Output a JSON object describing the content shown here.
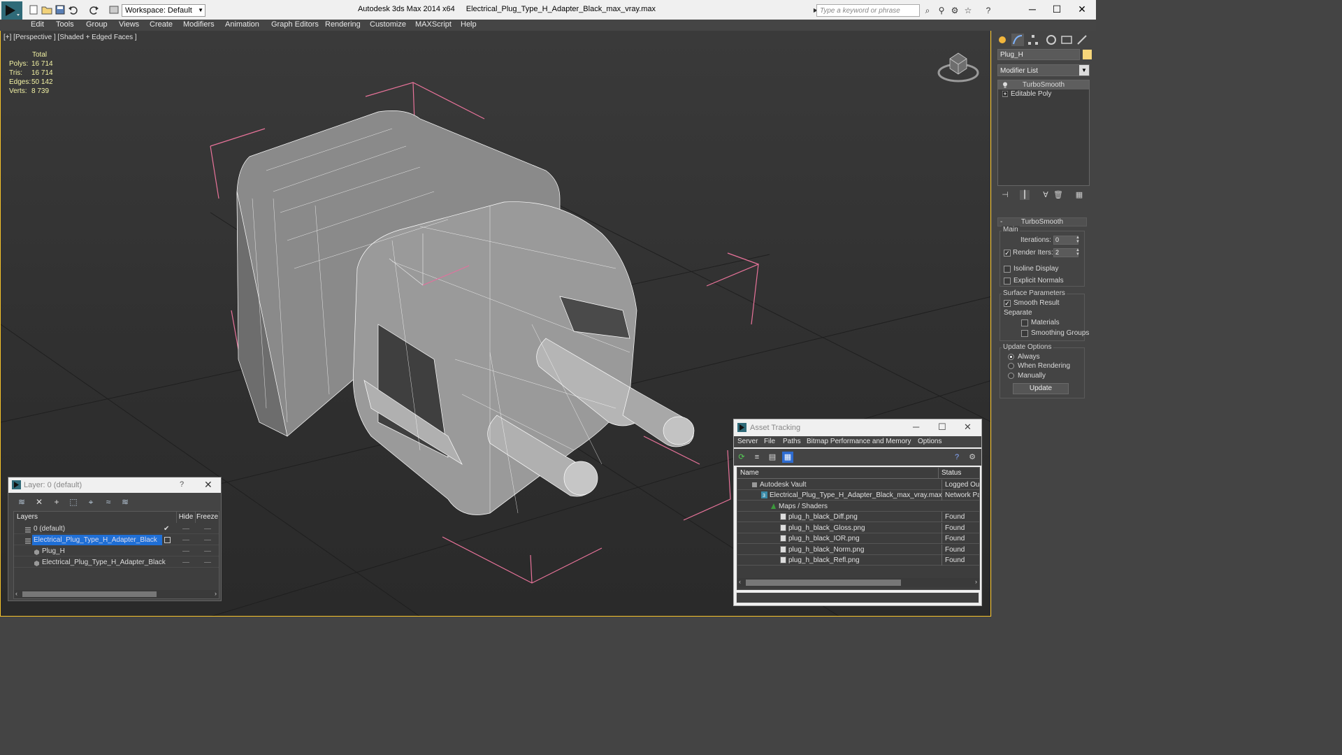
{
  "titlebar": {
    "workspace": "Workspace: Default",
    "app_name": "Autodesk 3ds Max  2014 x64",
    "file_name": "Electrical_Plug_Type_H_Adapter_Black_max_vray.max",
    "search_placeholder": "Type a keyword or phrase"
  },
  "menu": [
    "Edit",
    "Tools",
    "Group",
    "Views",
    "Create",
    "Modifiers",
    "Animation",
    "Graph Editors",
    "Rendering",
    "Customize",
    "MAXScript",
    "Help"
  ],
  "viewport": {
    "label": "[+] [Perspective ] [Shaded + Edged Faces ]",
    "stats": {
      "header": "Total",
      "rows": [
        {
          "label": "Polys:",
          "value": "16 714"
        },
        {
          "label": "Tris:",
          "value": "16 714"
        },
        {
          "label": "Edges:",
          "value": "50 142"
        },
        {
          "label": "Verts:",
          "value": "8 739"
        }
      ]
    }
  },
  "command_panel": {
    "object_name": "Plug_H",
    "object_color": "#f7d67a",
    "modifier_list": "Modifier List",
    "stack": [
      "TurboSmooth",
      "Editable Poly"
    ],
    "rollout_title": "TurboSmooth",
    "main_group": "Main",
    "iterations_label": "Iterations:",
    "iterations_value": "0",
    "render_iters_label": "Render Iters:",
    "render_iters_value": "2",
    "render_iters_checked": true,
    "isoline_label": "Isoline Display",
    "explicit_normals_label": "Explicit Normals",
    "surface_group": "Surface Parameters",
    "smooth_result_label": "Smooth Result",
    "separate_label": "Separate",
    "materials_label": "Materials",
    "smoothing_groups_label": "Smoothing Groups",
    "update_group": "Update Options",
    "always_label": "Always",
    "when_rendering_label": "When Rendering",
    "manually_label": "Manually",
    "update_button": "Update"
  },
  "layer_dialog": {
    "title": "Layer: 0 (default)",
    "help": "?",
    "col_layers": "Layers",
    "col_hide": "Hide",
    "col_freeze": "Freeze",
    "rows": [
      {
        "name": "0 (default)"
      },
      {
        "name": "Electrical_Plug_Type_H_Adapter_Black"
      },
      {
        "name": "Plug_H"
      },
      {
        "name": "Electrical_Plug_Type_H_Adapter_Black"
      }
    ]
  },
  "asset_dialog": {
    "title": "Asset Tracking",
    "menu": [
      "Server",
      "File",
      "Paths",
      "Bitmap Performance and Memory",
      "Options"
    ],
    "col_name": "Name",
    "col_status": "Status",
    "rows": [
      {
        "name": "Autodesk Vault",
        "status": "Logged Out"
      },
      {
        "name": "Electrical_Plug_Type_H_Adapter_Black_max_vray.max",
        "status": "Network Pat"
      },
      {
        "name": "Maps / Shaders",
        "status": ""
      },
      {
        "name": "plug_h_black_Diff.png",
        "status": "Found"
      },
      {
        "name": "plug_h_black_Gloss.png",
        "status": "Found"
      },
      {
        "name": "plug_h_black_IOR.png",
        "status": "Found"
      },
      {
        "name": "plug_h_black_Norm.png",
        "status": "Found"
      },
      {
        "name": "plug_h_black_Refl.png",
        "status": "Found"
      }
    ]
  }
}
